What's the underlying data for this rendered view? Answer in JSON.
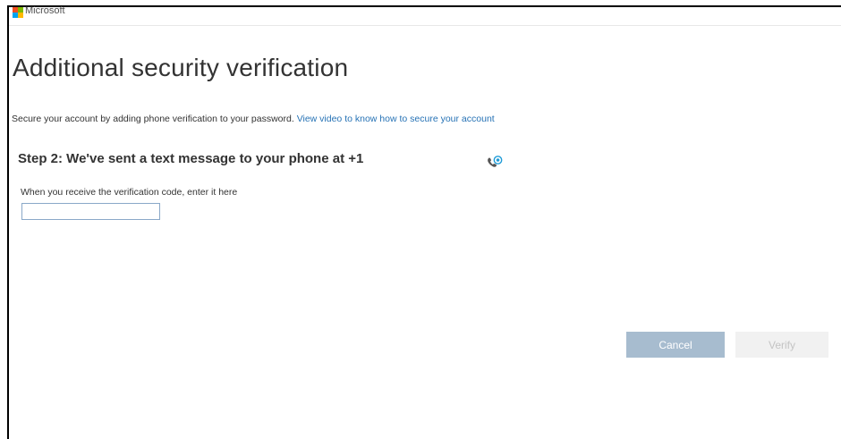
{
  "header": {
    "brand": "Microsoft",
    "logo_colors": [
      "#f25022",
      "#7fba00",
      "#00a4ef",
      "#ffb900"
    ]
  },
  "title": "Additional security verification",
  "intro": {
    "text": "Secure your account by adding phone verification to your password. ",
    "link_text": "View video to know how to secure your account"
  },
  "step": {
    "heading": "Step 2: We've sent a text message to your phone at +1",
    "icon": "phone-call-icon",
    "hint": "When you receive the verification code, enter it here",
    "code_value": ""
  },
  "buttons": {
    "cancel_label": "Cancel",
    "verify_label": "Verify"
  },
  "colors": {
    "link": "#2672b5",
    "cancel_bg": "#a7bccf",
    "verify_bg": "#f1f1f1",
    "icon_blue": "#1e9bd7"
  }
}
